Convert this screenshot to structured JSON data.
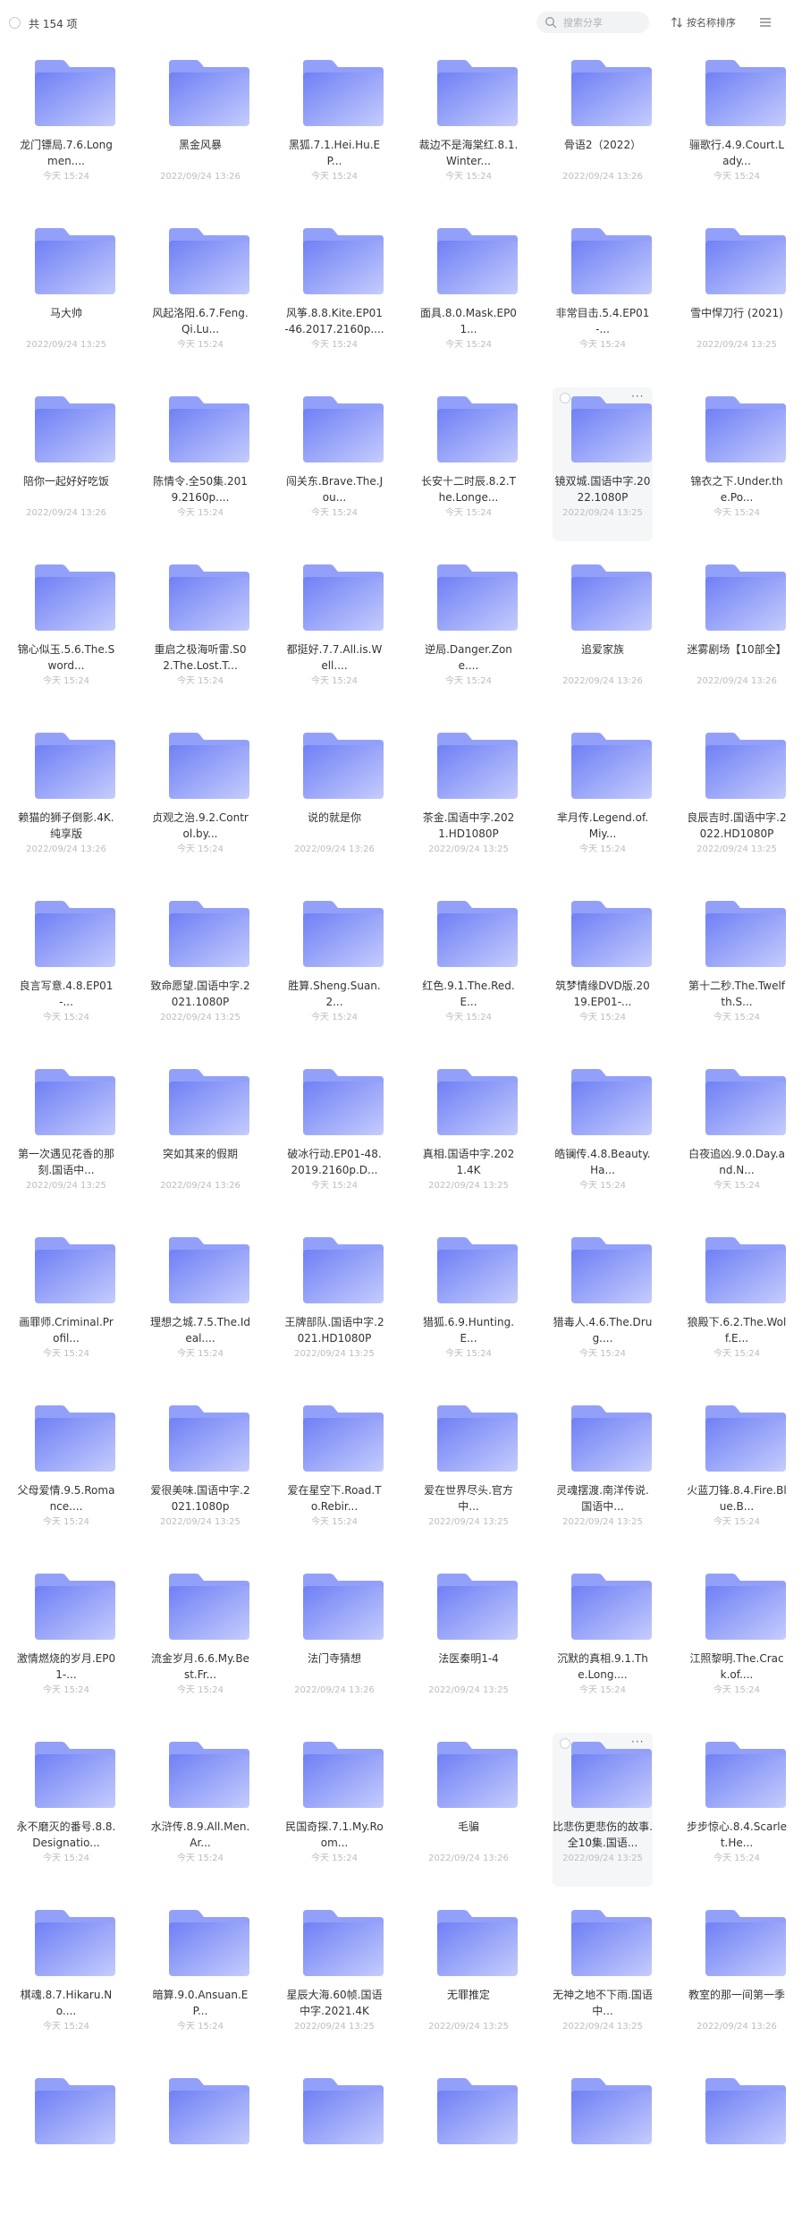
{
  "toolbar": {
    "count_label": "共 154 项",
    "search_placeholder": "搜索分享",
    "sort_label": "按名称排序",
    "icons": {
      "search": "search-icon",
      "sort": "sort-icon",
      "menu": "list-menu-icon",
      "select_all": "select-all-circle"
    }
  },
  "colors": {
    "folder_front": "#7b8cf7",
    "folder_back": "#9aa6fb",
    "accent": "#5c6cf2"
  },
  "items": [
    {
      "name": "龙门镖局.7.6.Longmen....",
      "time": "今天 15:24"
    },
    {
      "name": "黑金风暴",
      "time": "2022/09/24 13:26"
    },
    {
      "name": "黑狐.7.1.Hei.Hu.EP...",
      "time": "今天 15:24"
    },
    {
      "name": "裁边不是海棠红.8.1.Winter...",
      "time": "今天 15:24"
    },
    {
      "name": "骨语2（2022）",
      "time": "2022/09/24 13:26"
    },
    {
      "name": "骊歌行.4.9.Court.Lady...",
      "time": "今天 15:24"
    },
    {
      "name": "马大帅",
      "time": "2022/09/24 13:25"
    },
    {
      "name": "风起洛阳.6.7.Feng.Qi.Lu...",
      "time": "今天 15:24"
    },
    {
      "name": "风筝.8.8.Kite.EP01-46.2017.2160p....",
      "time": "今天 15:24"
    },
    {
      "name": "面具.8.0.Mask.EP01...",
      "time": "今天 15:24"
    },
    {
      "name": "非常目击.5.4.EP01-...",
      "time": "今天 15:24"
    },
    {
      "name": "雪中悍刀行 (2021)",
      "time": "2022/09/24 13:25"
    },
    {
      "name": "陪你一起好好吃饭",
      "time": "2022/09/24 13:26"
    },
    {
      "name": "陈情令.全50集.2019.2160p....",
      "time": "今天 15:24"
    },
    {
      "name": "闯关东.Brave.The.Jou...",
      "time": "今天 15:24"
    },
    {
      "name": "长安十二时辰.8.2.The.Longe...",
      "time": "今天 15:24"
    },
    {
      "name": "镜双城.国语中字.2022.1080P",
      "time": "2022/09/24 13:25"
    },
    {
      "name": "锦衣之下.Under.the.Po...",
      "time": "今天 15:24"
    },
    {
      "name": "锦心似玉.5.6.The.Sword...",
      "time": "今天 15:24"
    },
    {
      "name": "重启之极海听雷.S02.The.Lost.T...",
      "time": "今天 15:24"
    },
    {
      "name": "都挺好.7.7.All.is.Well....",
      "time": "今天 15:24"
    },
    {
      "name": "逆局.Danger.Zone....",
      "time": "今天 15:24"
    },
    {
      "name": "追爱家族",
      "time": "2022/09/24 13:26"
    },
    {
      "name": "迷雾剧场【10部全】",
      "time": "2022/09/24 13:26"
    },
    {
      "name": "赖猫的狮子倒影.4K.纯享版",
      "time": "2022/09/24 13:26"
    },
    {
      "name": "贞观之治.9.2.Control.by...",
      "time": "今天 15:24"
    },
    {
      "name": "说的就是你",
      "time": "2022/09/24 13:26"
    },
    {
      "name": "茶金.国语中字.2021.HD1080P",
      "time": "2022/09/24 13:25"
    },
    {
      "name": "芈月传.Legend.of.Miy...",
      "time": "今天 15:24"
    },
    {
      "name": "良辰吉时.国语中字.2022.HD1080P",
      "time": "2022/09/24 13:25"
    },
    {
      "name": "良言写意.4.8.EP01-...",
      "time": "今天 15:24"
    },
    {
      "name": "致命愿望.国语中字.2021.1080P",
      "time": "2022/09/24 13:25"
    },
    {
      "name": "胜算.Sheng.Suan.2...",
      "time": "今天 15:24"
    },
    {
      "name": "红色.9.1.The.Red.E...",
      "time": "今天 15:24"
    },
    {
      "name": "筑梦情缘DVD版.2019.EP01-...",
      "time": "今天 15:24"
    },
    {
      "name": "第十二秒.The.Twelfth.S...",
      "time": "今天 15:24"
    },
    {
      "name": "第一次遇见花香的那刻.国语中...",
      "time": "2022/09/24 13:25"
    },
    {
      "name": "突如其来的假期",
      "time": "2022/09/24 13:26"
    },
    {
      "name": "破冰行动.EP01-48.2019.2160p.D...",
      "time": "今天 15:24"
    },
    {
      "name": "真相.国语中字.2021.4K",
      "time": "2022/09/24 13:25"
    },
    {
      "name": "皓镧传.4.8.Beauty.Ha...",
      "time": "今天 15:24"
    },
    {
      "name": "白夜追凶.9.0.Day.and.N...",
      "time": "今天 15:24"
    },
    {
      "name": "画罪师.Criminal.Profil...",
      "time": "今天 15:24"
    },
    {
      "name": "理想之城.7.5.The.Ideal....",
      "time": "今天 15:24"
    },
    {
      "name": "王牌部队.国语中字.2021.HD1080P",
      "time": "2022/09/24 13:25"
    },
    {
      "name": "猎狐.6.9.Hunting.E...",
      "time": "今天 15:24"
    },
    {
      "name": "猎毒人.4.6.The.Drug....",
      "time": "今天 15:24"
    },
    {
      "name": "狼殿下.6.2.The.Wolf.E...",
      "time": "今天 15:24"
    },
    {
      "name": "父母爱情.9.5.Romance....",
      "time": "今天 15:24"
    },
    {
      "name": "爱很美味.国语中字.2021.1080p",
      "time": "2022/09/24 13:25"
    },
    {
      "name": "爱在星空下.Road.To.Rebir...",
      "time": "今天 15:24"
    },
    {
      "name": "爱在世界尽头.官方中...",
      "time": "2022/09/24 13:25"
    },
    {
      "name": "灵魂摆渡.南洋传说.国语中...",
      "time": "2022/09/24 13:25"
    },
    {
      "name": "火蓝刀锋.8.4.Fire.Blue.B...",
      "time": "今天 15:24"
    },
    {
      "name": "激情燃烧的岁月.EP01-...",
      "time": "今天 15:24"
    },
    {
      "name": "流金岁月.6.6.My.Best.Fr...",
      "time": "今天 15:24"
    },
    {
      "name": "法门寺猜想",
      "time": "2022/09/24 13:26"
    },
    {
      "name": "法医秦明1-4",
      "time": "2022/09/24 13:25"
    },
    {
      "name": "沉默的真相.9.1.The.Long....",
      "time": "今天 15:24"
    },
    {
      "name": "江照黎明.The.Crack.of....",
      "time": "今天 15:24"
    },
    {
      "name": "永不磨灭的番号.8.8.Designatio...",
      "time": "今天 15:24"
    },
    {
      "name": "水浒传.8.9.All.Men.Ar...",
      "time": "今天 15:24"
    },
    {
      "name": "民国奇探.7.1.My.Room...",
      "time": "今天 15:24"
    },
    {
      "name": "毛骗",
      "time": "2022/09/24 13:26"
    },
    {
      "name": "比悲伤更悲伤的故事.全10集.国语...",
      "time": "2022/09/24 13:25"
    },
    {
      "name": "步步惊心.8.4.Scarlet.He...",
      "time": "今天 15:24"
    },
    {
      "name": "棋魂.8.7.Hikaru.No....",
      "time": "今天 15:24"
    },
    {
      "name": "暗算.9.0.Ansuan.EP...",
      "time": "今天 15:24"
    },
    {
      "name": "星辰大海.60帧.国语中字.2021.4K",
      "time": "2022/09/24 13:25"
    },
    {
      "name": "无罪推定",
      "time": "2022/09/24 13:25"
    },
    {
      "name": "无神之地不下雨.国语中...",
      "time": "2022/09/24 13:25"
    },
    {
      "name": "教室的那一间第一季",
      "time": "2022/09/24 13:26"
    },
    {
      "name": "",
      "time": ""
    },
    {
      "name": "",
      "time": ""
    },
    {
      "name": "",
      "time": ""
    },
    {
      "name": "",
      "time": ""
    },
    {
      "name": "",
      "time": ""
    },
    {
      "name": "",
      "time": ""
    }
  ],
  "hover_indices": [
    16,
    64
  ],
  "more_glyph": "···"
}
